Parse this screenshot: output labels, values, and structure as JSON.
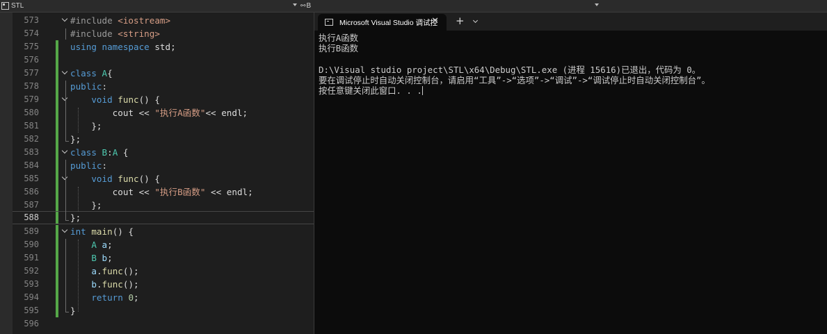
{
  "navbar": {
    "project": "STL",
    "member_prefix": "B"
  },
  "editor": {
    "current_line": "588",
    "lines": [
      {
        "number": "573",
        "text": "#include <iostream>"
      },
      {
        "number": "574",
        "text": "#include <string>"
      },
      {
        "number": "575",
        "text": "using namespace std;"
      },
      {
        "number": "576",
        "text": ""
      },
      {
        "number": "577",
        "text": "class A{"
      },
      {
        "number": "578",
        "text": "public:"
      },
      {
        "number": "579",
        "text": "void func() {"
      },
      {
        "number": "580",
        "text": "cout << \"执行A函数\"<< endl;"
      },
      {
        "number": "581",
        "text": "};"
      },
      {
        "number": "582",
        "text": "};"
      },
      {
        "number": "583",
        "text": "class B:A {"
      },
      {
        "number": "584",
        "text": "public:"
      },
      {
        "number": "585",
        "text": "void func() {"
      },
      {
        "number": "586",
        "text": "cout << \"执行B函数\" << endl;"
      },
      {
        "number": "587",
        "text": "};"
      },
      {
        "number": "588",
        "text": "};"
      },
      {
        "number": "589",
        "text": "int main() {"
      },
      {
        "number": "590",
        "text": "A a;"
      },
      {
        "number": "591",
        "text": "B b;"
      },
      {
        "number": "592",
        "text": "a.func();"
      },
      {
        "number": "593",
        "text": "b.func();"
      },
      {
        "number": "594",
        "text": "return 0;"
      },
      {
        "number": "595",
        "text": "}"
      },
      {
        "number": "596",
        "text": ""
      }
    ]
  },
  "terminal": {
    "tab_title": "Microsoft Visual Studio 调试控",
    "close_icon": "close-icon",
    "new_tab_label": "+",
    "output": [
      "执行A函数",
      "执行B函数",
      "",
      "D:\\Visual studio project\\STL\\x64\\Debug\\STL.exe (进程 15616)已退出，代码为 0。",
      "要在调试停止时自动关闭控制台，请启用“工具”->“选项”->“调试”->“调试停止时自动关闭控制台”。",
      "按任意键关闭此窗口. . ."
    ]
  }
}
